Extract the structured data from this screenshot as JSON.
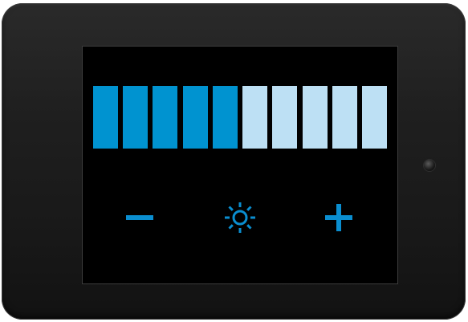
{
  "device": {
    "brightness_level": 5,
    "brightness_max": 10
  },
  "colors": {
    "bar_active": "#0093d0",
    "bar_inactive": "#bde0f4",
    "icon": "#0a8ed0",
    "screen": "#000000",
    "bezel": "#1c1c1c"
  },
  "controls": {
    "decrease_icon": "minus-icon",
    "brightness_icon": "sun-icon",
    "increase_icon": "plus-icon"
  }
}
